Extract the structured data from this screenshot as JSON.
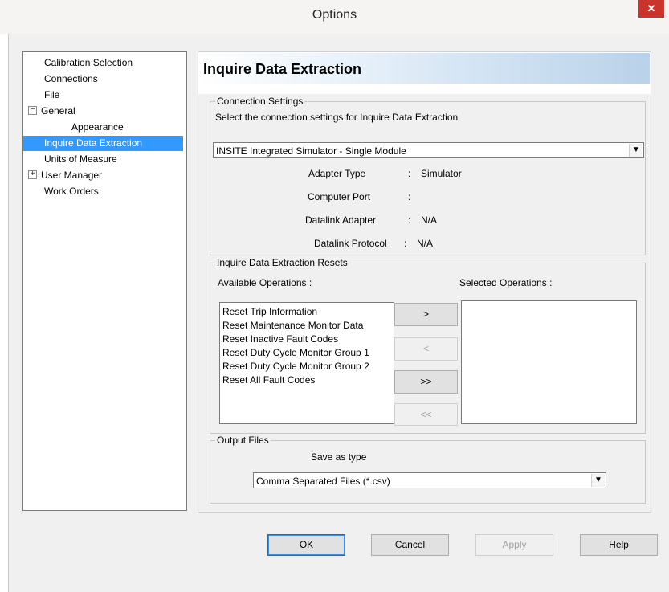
{
  "window": {
    "title": "Options",
    "close_label": "✕"
  },
  "tree": {
    "items": [
      {
        "label": "Calibration Selection"
      },
      {
        "label": "Connections"
      },
      {
        "label": "File"
      },
      {
        "label": "General",
        "expander": "⊟"
      },
      {
        "label": "Appearance"
      },
      {
        "label": "Inquire Data Extraction"
      },
      {
        "label": "Units of Measure"
      },
      {
        "label": "User Manager",
        "expander": "⊞"
      },
      {
        "label": "Work Orders"
      }
    ],
    "selected": "Inquire Data Extraction"
  },
  "panel": {
    "title": "Inquire Data Extraction",
    "connection_settings": {
      "group_label": "Connection Settings",
      "description": "Select the connection settings for Inquire Data Extraction",
      "selected_connection": "INSITE Integrated Simulator - Single Module",
      "fields": [
        {
          "label": "Adapter Type",
          "sep": ":",
          "value": "Simulator"
        },
        {
          "label": "Computer Port",
          "sep": ":",
          "value": ""
        },
        {
          "label": "Datalink Adapter",
          "sep": ":",
          "value": "N/A"
        },
        {
          "label": "Datalink Protocol",
          "sep": ":",
          "value": "N/A"
        }
      ]
    },
    "resets": {
      "group_label": "Inquire Data Extraction Resets",
      "available_label": "Available Operations :",
      "selected_label": "Selected Operations :",
      "available": [
        "Reset Trip Information",
        "Reset Maintenance Monitor Data",
        "Reset Inactive Fault Codes",
        "Reset Duty Cycle Monitor Group 1",
        "Reset Duty Cycle Monitor Group 2",
        "Reset All Fault Codes"
      ],
      "selected": [],
      "buttons": {
        "add": ">",
        "remove": "<",
        "add_all": ">>",
        "remove_all": "<<"
      }
    },
    "output_files": {
      "group_label": "Output Files",
      "save_as_label": "Save as type",
      "save_as_value": "Comma Separated Files (*.csv)"
    }
  },
  "footer": {
    "ok": "OK",
    "cancel": "Cancel",
    "apply": "Apply",
    "help": "Help"
  },
  "icons": {
    "dropdown": "▼"
  }
}
